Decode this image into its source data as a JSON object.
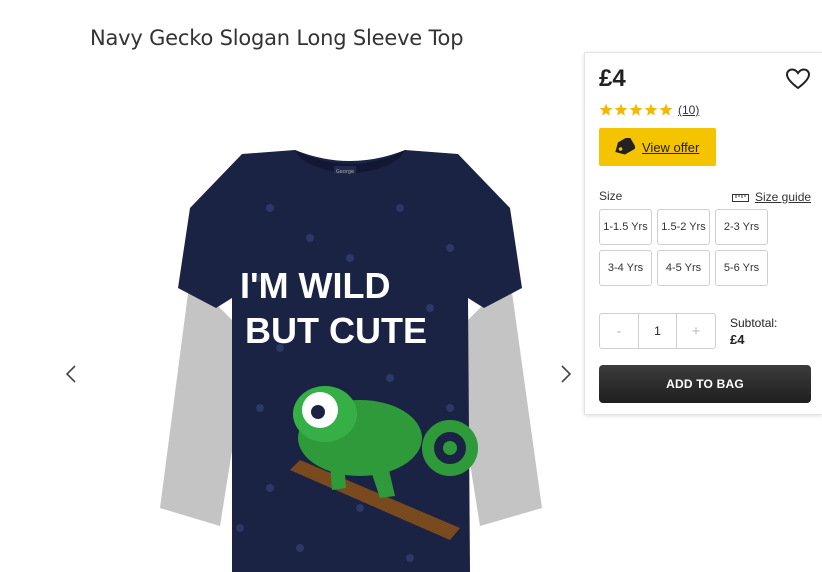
{
  "product": {
    "title": "Navy Gecko Slogan Long Sleeve Top",
    "price": "£4",
    "rating": 5,
    "review_count": "(10)",
    "image_alt": "Navy Gecko Slogan Long Sleeve Top",
    "slogan_line1": "I'M WILD",
    "slogan_line2": "BUT CUTE",
    "label_text": "George"
  },
  "gallery": {
    "prev_icon": "chevron-left-icon",
    "next_icon": "chevron-right-icon"
  },
  "offer": {
    "label": "View offer",
    "icon": "tag-icon"
  },
  "size": {
    "label": "Size",
    "guide_label": "Size guide",
    "options": [
      "1-1.5 Yrs",
      "1.5-2 Yrs",
      "2-3 Yrs",
      "3-4 Yrs",
      "4-5 Yrs",
      "5-6 Yrs"
    ]
  },
  "quantity": {
    "minus": "-",
    "value": "1",
    "plus": "+"
  },
  "subtotal": {
    "label": "Subtotal:",
    "value": "£4"
  },
  "cart": {
    "add_label": "ADD TO BAG"
  },
  "colors": {
    "accent": "#f5c400",
    "star": "#f5b800",
    "button": "#2a2a2a"
  }
}
